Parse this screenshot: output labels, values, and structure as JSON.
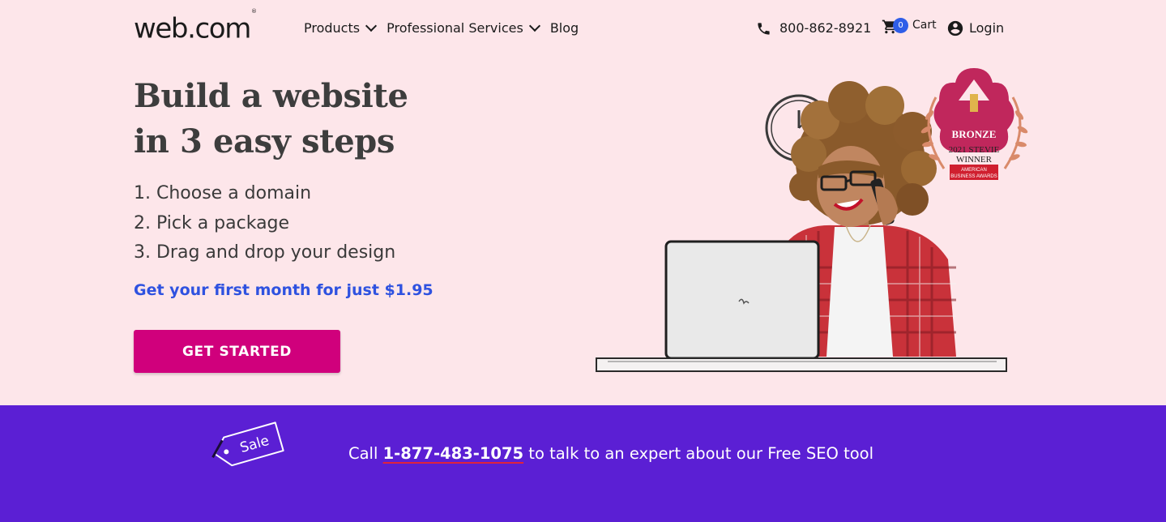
{
  "header": {
    "logo": "web.com",
    "logo_mark": "®",
    "nav": [
      {
        "label": "Products",
        "has_dropdown": true
      },
      {
        "label": "Professional Services",
        "has_dropdown": true
      },
      {
        "label": "Blog",
        "has_dropdown": false
      }
    ],
    "phone": "800-862-8921",
    "cart_count": "0",
    "cart_label": "Cart",
    "login_label": "Login"
  },
  "hero": {
    "title_line1": "Build a website",
    "title_line2": "in 3 easy steps",
    "steps": [
      "1. Choose a domain",
      "2. Pick a package",
      "3. Drag and drop your design"
    ],
    "offer": "Get your first month for just $1.95",
    "cta_label": "GET STARTED"
  },
  "award": {
    "tier": "BRONZE",
    "line1": "2021 STEVIE",
    "line2": "WINNER",
    "line3": "AMERICAN",
    "line4": "BUSINESS AWARDS"
  },
  "promo": {
    "sale_tag": "Sale",
    "prefix": "Call ",
    "phone": "1-877-483-1075",
    "suffix": " to talk to an expert about our Free SEO tool"
  },
  "colors": {
    "page_bg": "#fde6ea",
    "cta": "#d0007c",
    "offer": "#2f52e0",
    "promo_bg": "#5b1fd4",
    "cart_badge": "#2f5ee8"
  }
}
